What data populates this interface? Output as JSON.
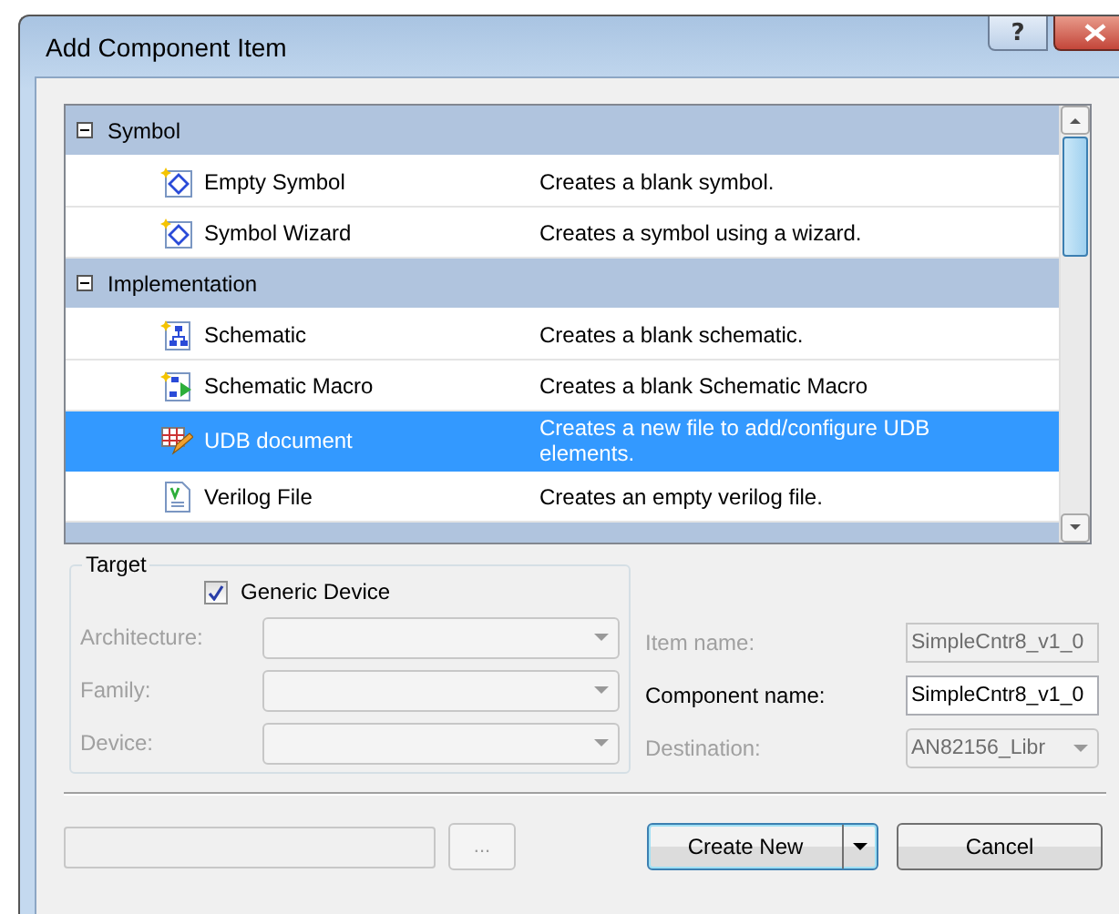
{
  "window": {
    "title": "Add Component Item",
    "help": "?"
  },
  "templates": {
    "groups": [
      {
        "label": "Symbol",
        "expanded": true,
        "items": [
          {
            "name": "Empty Symbol",
            "description": "Creates a blank symbol.",
            "selected": false,
            "kind": "symbol"
          },
          {
            "name": "Symbol Wizard",
            "description": "Creates a symbol using a wizard.",
            "selected": false,
            "kind": "symbol"
          }
        ]
      },
      {
        "label": "Implementation",
        "expanded": true,
        "items": [
          {
            "name": "Schematic",
            "description": "Creates a blank schematic.",
            "selected": false,
            "kind": "schematic"
          },
          {
            "name": "Schematic Macro",
            "description": "Creates a blank Schematic Macro",
            "selected": false,
            "kind": "macro"
          },
          {
            "name": "UDB document",
            "description": "Creates a new file to add/configure UDB elements.",
            "selected": true,
            "kind": "udb"
          },
          {
            "name": "Verilog File",
            "description": "Creates an empty verilog file.",
            "selected": false,
            "kind": "verilog"
          }
        ]
      }
    ]
  },
  "target": {
    "title": "Target",
    "generic_device": {
      "label": "Generic Device",
      "checked": true
    },
    "fields": [
      {
        "label": "Architecture:",
        "disabled": true
      },
      {
        "label": "Family:",
        "disabled": true
      },
      {
        "label": "Device:",
        "disabled": true
      }
    ]
  },
  "names": [
    {
      "label": "Item name:",
      "value": "SimpleCntr8_v1_0",
      "disabled": true,
      "kind": "text"
    },
    {
      "label": "Component name:",
      "value": "SimpleCntr8_v1_0",
      "disabled": false,
      "kind": "text"
    },
    {
      "label": "Destination:",
      "value": "AN82156_Libr",
      "disabled": true,
      "kind": "select"
    }
  ],
  "buttons": {
    "browse": "...",
    "create": "Create New",
    "cancel": "Cancel"
  }
}
